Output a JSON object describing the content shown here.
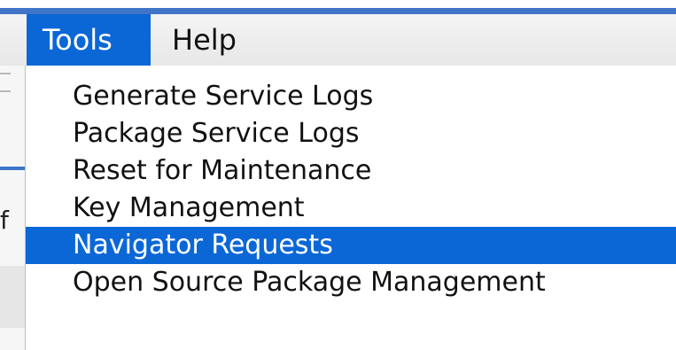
{
  "menubar": {
    "menus": [
      {
        "label": "Tools",
        "active": true
      },
      {
        "label": "Help",
        "active": false
      }
    ]
  },
  "background": {
    "fragment_text": "f"
  },
  "tools_menu": {
    "items": [
      {
        "label": "Generate Service Logs",
        "highlighted": false
      },
      {
        "label": "Package Service Logs",
        "highlighted": false
      },
      {
        "label": "Reset for Maintenance",
        "highlighted": false
      },
      {
        "label": "Key Management",
        "highlighted": false
      },
      {
        "label": "Navigator Requests",
        "highlighted": true
      },
      {
        "label": "Open Source Package Management",
        "highlighted": false
      }
    ]
  },
  "colors": {
    "selection": "#0b67d6",
    "accent_strip": "#3f74c8"
  }
}
